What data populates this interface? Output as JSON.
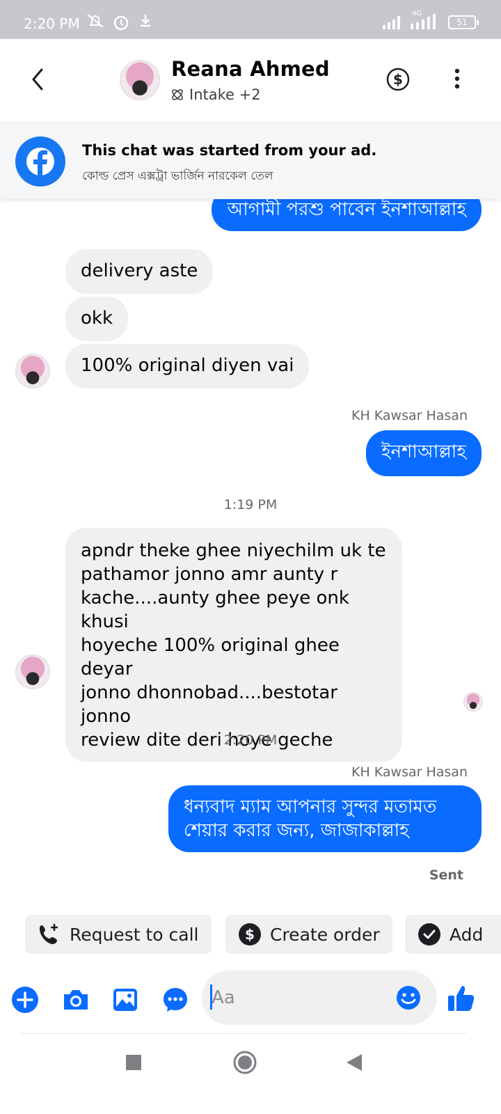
{
  "status_bar": {
    "time": "2:20 PM",
    "network": "4G",
    "battery": "51"
  },
  "header": {
    "contact_name": "Reana Ahmed",
    "subtitle": "Intake +2"
  },
  "ad_banner": {
    "title": "This chat was started from your ad.",
    "subtitle": "কোল্ড প্রেস এক্সট্রা ভার্জিন নারকেল তেল"
  },
  "messages": [
    {
      "text": "আগামী পরশু পাবেন ইনশাআল্লাহ"
    },
    {
      "text": "delivery aste"
    },
    {
      "text": "okk"
    },
    {
      "text": "100% original diyen vai"
    },
    {
      "sender": "KH Kawsar Hasan",
      "text": "ইনশাআল্লাহ"
    },
    {
      "time": "1:19 PM"
    },
    {
      "text": "apndr theke ghee niyechilm  uk te\npathamor jonno amr aunty r\nkache....aunty ghee peye onk khusi\nhoyeche 100% original ghee deyar\njonno dhonnobad....bestotar jonno\nreview dite deri hoye geche"
    },
    {
      "time": "2:20 PM"
    },
    {
      "sender": "KH Kawsar Hasan",
      "text": "ধন্যবাদ ম্যাম আপনার সুন্দর মতামত\nশেয়ার করার জন্য, জাজাকাল্লাহ",
      "status": "Sent"
    }
  ],
  "quick_replies": [
    {
      "label": "Request to call",
      "icon": "phone-plus-icon"
    },
    {
      "label": "Create order",
      "icon": "dollar-icon"
    },
    {
      "label": "Add",
      "icon": "check-circle-icon"
    }
  ],
  "composer": {
    "placeholder": "Aa"
  },
  "colors": {
    "accent": "#0a6cff",
    "incoming_bubble": "#f0f0f0",
    "status_bar": "#c6c8cc"
  }
}
